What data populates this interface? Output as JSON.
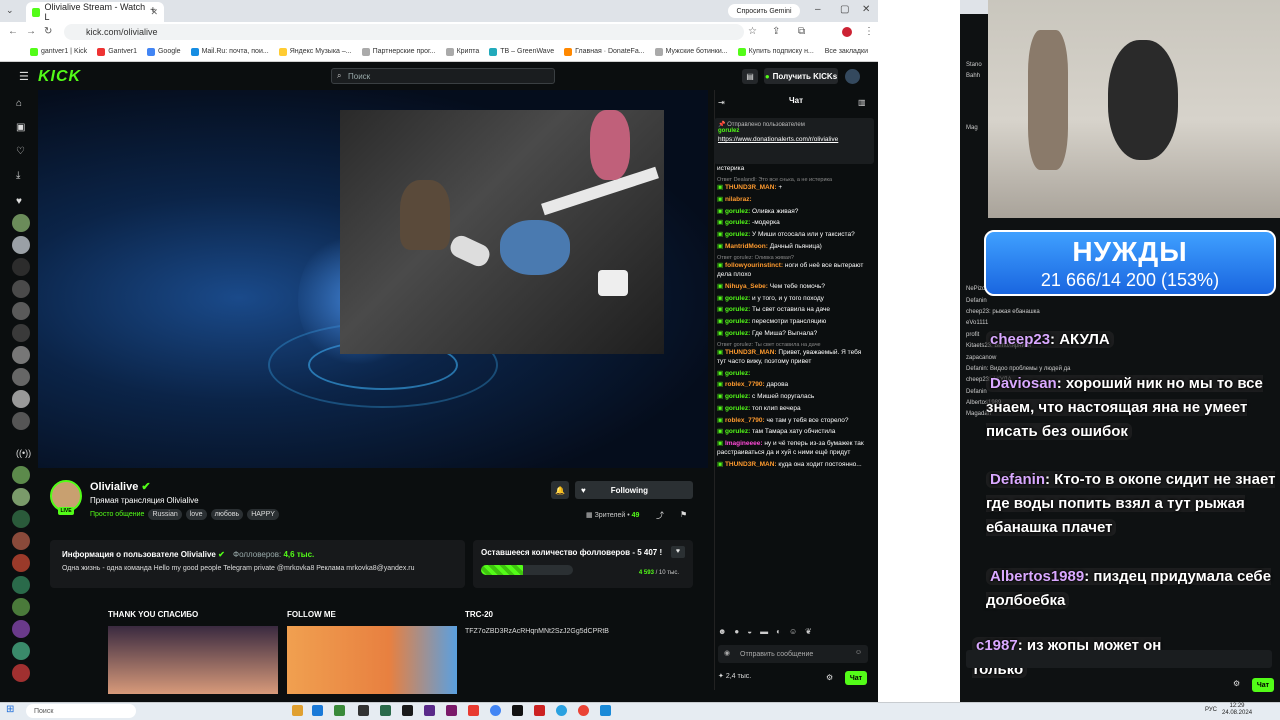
{
  "browser": {
    "tab_title": "Olivialive Stream - Watch L",
    "url": "kick.com/olivialive",
    "gemini_button": "Спросить Gemini",
    "bookmarks": [
      "gantver1 | Kick",
      "Gantver1",
      "Google",
      "Mail.Ru: почта, пои...",
      "Яндекс Музыка –...",
      "Партнерские прог...",
      "Крипта",
      "TB – GreenWave",
      "Главная · DonateFa...",
      "Мужские ботинки...",
      "Купить подписку н..."
    ],
    "all_bookmarks": "Все закладки"
  },
  "kick": {
    "logo": "KICK",
    "search_placeholder": "Поиск",
    "get_kicks": "Получить KICKs"
  },
  "streamer": {
    "name": "Olivialive",
    "title": "Прямая трансляция Olivialive",
    "category": "Просто общение",
    "tags": [
      "Russian",
      "love",
      "любовь",
      "HAPPY"
    ],
    "follow_label": "Following",
    "viewers_label": "Зрителей",
    "viewers_count": "49",
    "live_badge": "LIVE"
  },
  "info_card": {
    "heading": "Информация о пользователе Olivialive",
    "followers_label": "Фолловеров:",
    "followers_count": "4,6 тыс.",
    "bio": "Одна жизнь - одна команда Hello my good people   Telegram private @mrkovka8 Реклама mrkovka8@yandex.ru"
  },
  "goal_card": {
    "heading": "Оставшееся количество фолловеров - 5 407 !",
    "current": "4 593",
    "target": "/ 10 тыс.",
    "progress": 0.4593
  },
  "panels": [
    {
      "title": "THANK YOU СПАСИБО"
    },
    {
      "title": "FOLLOW ME"
    },
    {
      "title": "TRC-20",
      "text": "TFZ7oZBD3RzAcRHqnMNt2SzJ2Gg5dCPRtB"
    }
  ],
  "chat": {
    "title": "Чат",
    "pinned_label": "Отправлено пользователем",
    "pinned_user": "gorulez",
    "pinned_link": "https://www.donationalerts.com/r/olivialive",
    "messages": [
      {
        "user": "",
        "text": "истерика",
        "color": "#ffffff",
        "reply": ""
      },
      {
        "user": "THUND3R_MAN:",
        "text": "+",
        "color": "#ff9b2f",
        "reply": "Ответ Dealandl: Это все снька, а не истерика"
      },
      {
        "user": "nilabraz:",
        "text": "",
        "color": "#ff9b2f",
        "reply": ""
      },
      {
        "user": "gorulez:",
        "text": "Оливка живая?",
        "color": "#53fc18",
        "reply": ""
      },
      {
        "user": "gorulez:",
        "text": "-модерка",
        "color": "#53fc18",
        "reply": ""
      },
      {
        "user": "gorulez:",
        "text": "У Миши отсосала или у таксиста?",
        "color": "#53fc18",
        "reply": ""
      },
      {
        "user": "MantridMoon:",
        "text": "Дачный пьяница)",
        "color": "#ff9b2f",
        "reply": ""
      },
      {
        "user": "followyourinstinct:",
        "text": "ноги об неё все вытерают дела плохо",
        "color": "#ff9b2f",
        "reply": "Ответ gorulez: Оливка живая?"
      },
      {
        "user": "Nihuya_Sebe:",
        "text": "Чем тебе помочь?",
        "color": "#ff9b2f",
        "reply": ""
      },
      {
        "user": "gorulez:",
        "text": "и у того, и у того походу",
        "color": "#53fc18",
        "reply": ""
      },
      {
        "user": "gorulez:",
        "text": "Ты свет оставила на даче",
        "color": "#53fc18",
        "reply": ""
      },
      {
        "user": "gorulez:",
        "text": "пересмотри трансляцию",
        "color": "#53fc18",
        "reply": ""
      },
      {
        "user": "gorulez:",
        "text": "Где Миша? Выгнала?",
        "color": "#53fc18",
        "reply": ""
      },
      {
        "user": "THUND3R_MAN:",
        "text": "Привет, уважаемый. Я тебя тут часто вижу, поэтому привет",
        "color": "#ff9b2f",
        "reply": "Ответ gorulez: Ты свет оставила на даче"
      },
      {
        "user": "gorulez:",
        "text": "",
        "color": "#53fc18",
        "reply": ""
      },
      {
        "user": "roblex_7790:",
        "text": "дарова",
        "color": "#ff9b2f",
        "reply": ""
      },
      {
        "user": "gorulez:",
        "text": "с Мишей поругалась",
        "color": "#53fc18",
        "reply": ""
      },
      {
        "user": "gorulez:",
        "text": "топ клип вечера",
        "color": "#53fc18",
        "reply": ""
      },
      {
        "user": "roblex_7790:",
        "text": "че там у тебя все сторело?",
        "color": "#ff9b2f",
        "reply": ""
      },
      {
        "user": "gorulez:",
        "text": "там Тамара хату обчистила",
        "color": "#53fc18",
        "reply": ""
      },
      {
        "user": "Imagineeee:",
        "text": "ну и чё теперь из-за бумажек так расстраиваться да и хуй с ними ещё придут",
        "color": "#ff4ad8",
        "reply": ""
      },
      {
        "user": "THUND3R_MAN:",
        "text": "куда она ходит постоянно...",
        "color": "#ff9b2f",
        "reply": ""
      }
    ],
    "input_placeholder": "Отправить сообщение",
    "viewer_count": "2,4 тыс.",
    "send_label": "Чат"
  },
  "overlay": {
    "goal_title": "НУЖДЫ",
    "goal_value": "21 666/14 200 (153%)",
    "messages": [
      {
        "user": "cheep23",
        "text": ": АКУЛА"
      },
      {
        "user": "Daviosan",
        "text": ": хороший ник но мы то все знаем, что настоящая яна не умеет писать без ошибок"
      },
      {
        "user": "Defanin",
        "text": ": Кто-то в окопе сидит не знает где воды попить взял а тут рыжая ебанашка плачет"
      },
      {
        "user": "Albertos1989",
        "text": ": пиздец придумала себе долбоебка"
      },
      {
        "user": "c1987",
        "text": ": из жопы может он только"
      }
    ],
    "side_chat": [
      "Stano",
      "Bahh",
      "Mag",
      "NePizdabol: еще одна кончаная",
      "Defanin",
      "cheep23: рыжая ебанашка",
      "eVo1111",
      "profit",
      "Kitaets23: Биполярники",
      "zapacanow",
      "Defanin: Видоо проблемы у людей да",
      "cheep23: АКУЛА",
      "Defanin",
      "Albertos1989",
      "Magadan"
    ],
    "send_label": "Чат"
  },
  "taskbar": {
    "search_placeholder": "Поиск",
    "lang": "РУС",
    "time": "12:29",
    "date": "24.08.2024"
  },
  "colors": {
    "kick_green": "#53fc18",
    "bg": "#0b0e0f",
    "goal_blue": "#1a66e0"
  }
}
